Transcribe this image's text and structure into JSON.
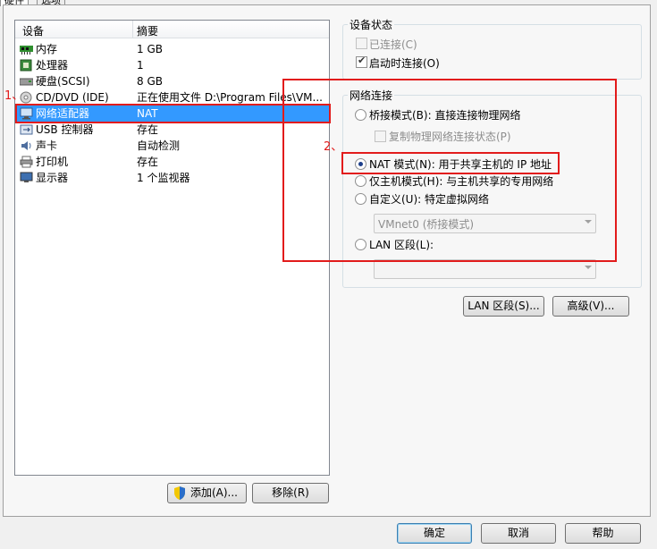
{
  "tabs": [
    "硬件",
    "选项"
  ],
  "device_list": {
    "col_device": "设备",
    "col_summary": "摘要",
    "rows": [
      {
        "name": "内存",
        "summary": "1 GB",
        "icon": "memory-icon"
      },
      {
        "name": "处理器",
        "summary": "1",
        "icon": "cpu-icon"
      },
      {
        "name": "硬盘(SCSI)",
        "summary": "8 GB",
        "icon": "harddisk-icon"
      },
      {
        "name": "CD/DVD (IDE)",
        "summary": "正在使用文件 D:\\Program Files\\VM...",
        "icon": "cdrom-icon"
      },
      {
        "name": "网络适配器",
        "summary": "NAT",
        "icon": "network-adapter-icon",
        "selected": true
      },
      {
        "name": "USB 控制器",
        "summary": "存在",
        "icon": "usb-icon"
      },
      {
        "name": "声卡",
        "summary": "自动检测",
        "icon": "sound-card-icon"
      },
      {
        "name": "打印机",
        "summary": "存在",
        "icon": "printer-icon"
      },
      {
        "name": "显示器",
        "summary": "1 个监视器",
        "icon": "monitor-icon"
      }
    ]
  },
  "buttons": {
    "add": "添加(A)...",
    "remove": "移除(R)",
    "lan_segments": "LAN 区段(S)...",
    "advanced": "高级(V)...",
    "ok": "确定",
    "cancel": "取消",
    "help": "帮助"
  },
  "device_status": {
    "title": "设备状态",
    "connected": {
      "label": "已连接(C)",
      "checked": false,
      "enabled": false
    },
    "connect_at_power_on": {
      "label": "启动时连接(O)",
      "checked": true,
      "enabled": true
    }
  },
  "network_connection": {
    "title": "网络连接",
    "bridged": "桥接模式(B): 直接连接物理网络",
    "replicate": "复制物理网络连接状态(P)",
    "nat": "NAT 模式(N): 用于共享主机的 IP 地址",
    "host_only": "仅主机模式(H): 与主机共享的专用网络",
    "custom": "自定义(U): 特定虚拟网络",
    "custom_select": "VMnet0 (桥接模式)",
    "lan_segment": "LAN 区段(L):",
    "lan_select": "",
    "selected": "nat"
  },
  "annotations": {
    "one": "1、",
    "two": "2、"
  },
  "colors": {
    "selection": "#3399ff",
    "annotation": "#e21b1b"
  }
}
